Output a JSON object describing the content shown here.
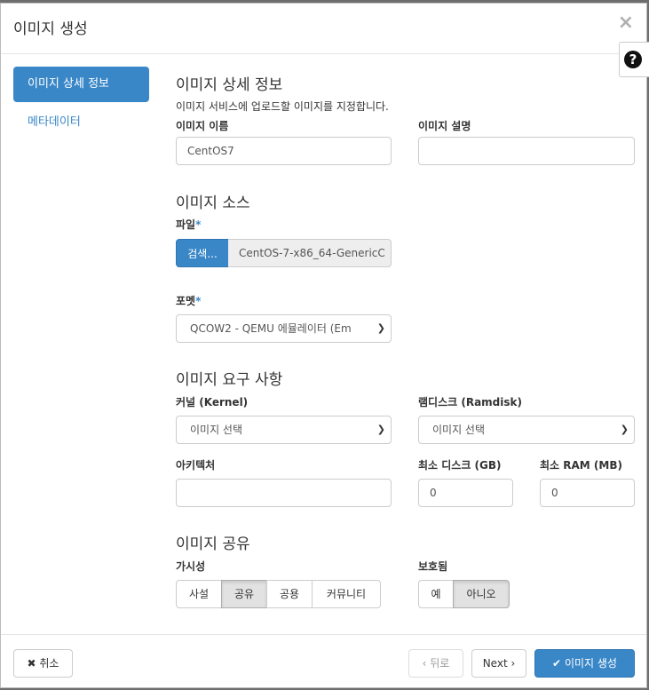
{
  "modal": {
    "title": "이미지 생성",
    "close": "×",
    "help": "?"
  },
  "nav": {
    "items": [
      {
        "label": "이미지 상세 정보",
        "active": true
      },
      {
        "label": "메타데이터",
        "active": false
      }
    ]
  },
  "details": {
    "title": "이미지 상세 정보",
    "hint": "이미지 서비스에 업로드할 이미지를 지정합니다.",
    "name_label": "이미지 이름",
    "name_value": "CentOS7",
    "desc_label": "이미지 설명",
    "desc_value": ""
  },
  "source": {
    "title": "이미지 소스",
    "file_label": "파일",
    "required_mark": "*",
    "browse_label": "검색...",
    "file_name": "CentOS-7-x86_64-GenericC",
    "format_label": "포멧",
    "format_value": "QCOW2 - QEMU 에뮬레이터 (Em"
  },
  "requirements": {
    "title": "이미지 요구 사항",
    "kernel_label": "커널 (Kernel)",
    "kernel_value": "이미지 선택",
    "ramdisk_label": "램디스크 (Ramdisk)",
    "ramdisk_value": "이미지 선택",
    "arch_label": "아키텍처",
    "arch_value": "",
    "min_disk_label": "최소 디스크 (GB)",
    "min_disk_value": "0",
    "min_ram_label": "최소 RAM (MB)",
    "min_ram_value": "0"
  },
  "sharing": {
    "title": "이미지 공유",
    "visibility_label": "가시성",
    "visibility_options": [
      "사설",
      "공유",
      "공용",
      "커뮤니티"
    ],
    "visibility_selected": "공유",
    "protected_label": "보호됨",
    "protected_options": [
      "예",
      "아니오"
    ],
    "protected_selected": "아니오"
  },
  "footer": {
    "cancel_label": "취소",
    "back_label": "‹ 뒤로",
    "next_label": "Next ›",
    "create_label": "이미지 생성"
  },
  "colors": {
    "accent": "#3a87c8"
  }
}
